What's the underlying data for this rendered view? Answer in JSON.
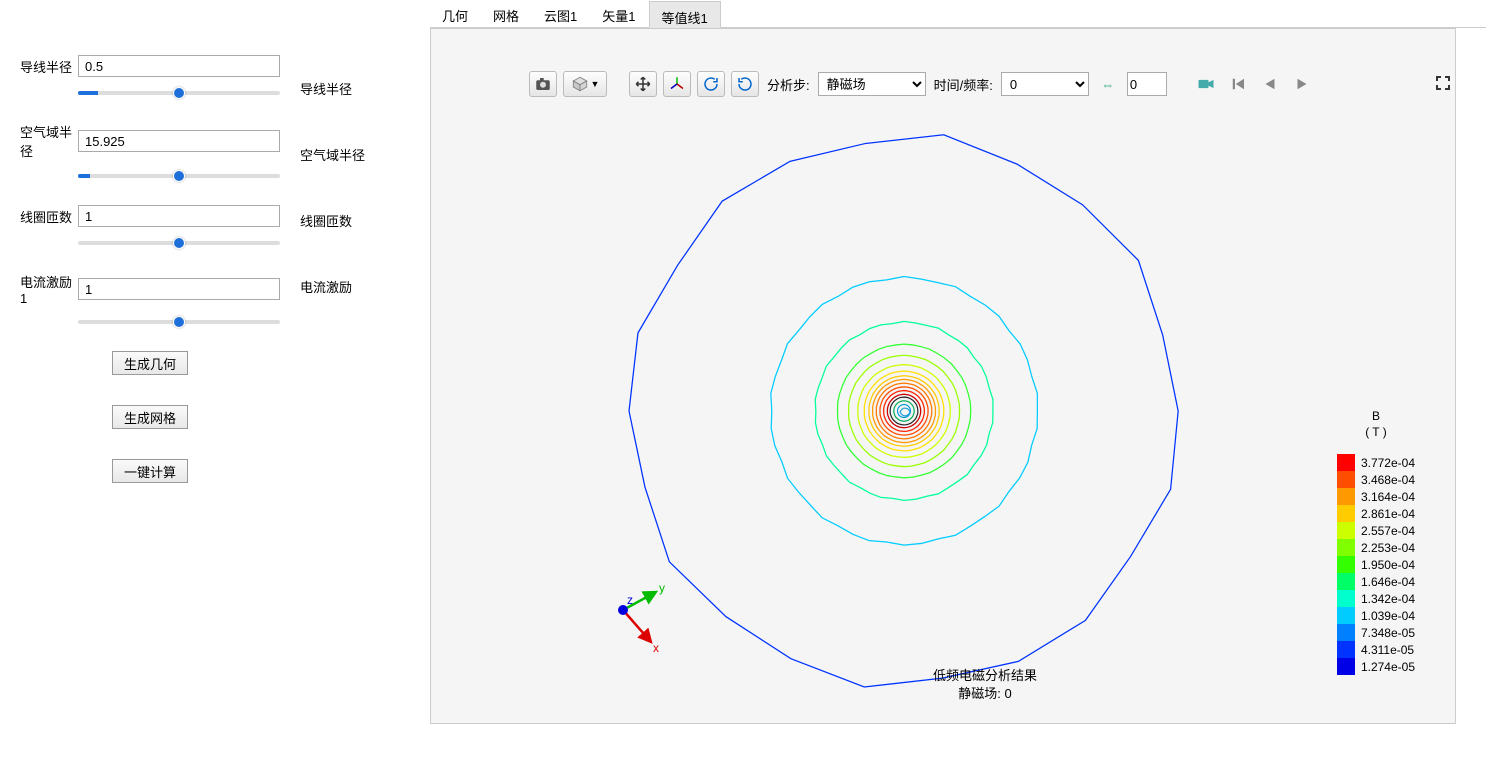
{
  "params": {
    "wire_radius": {
      "label": "导线半径",
      "value": "0.5",
      "slider_percent": 10
    },
    "air_radius": {
      "label": "空气域半径",
      "value": "15.925",
      "slider_percent": 6
    },
    "coil_turns": {
      "label": "线圈匝数",
      "value": "1",
      "slider_percent": 0
    },
    "current_exc": {
      "label": "电流激励1",
      "value": "1",
      "slider_percent": 0
    }
  },
  "mid_labels": {
    "wire_radius": "导线半径",
    "air_radius": "空气域半径",
    "coil_turns": "线圈匝数",
    "current_exc": "电流激励"
  },
  "buttons": {
    "gen_geom": "生成几何",
    "gen_mesh": "生成网格",
    "compute": "一键计算"
  },
  "tabs": [
    "几何",
    "网格",
    "云图1",
    "矢量1",
    "等值线1"
  ],
  "active_tab_index": 4,
  "toolbar": {
    "step_label": "分析步:",
    "step_value": "静磁场",
    "time_label": "时间/频率:",
    "time_value": "0",
    "spinner_value": "0"
  },
  "legend": {
    "title_line1": "B",
    "title_line2": "( T )",
    "entries": [
      {
        "color": "#ff0000",
        "value": "3.772e-04"
      },
      {
        "color": "#ff4d00",
        "value": "3.468e-04"
      },
      {
        "color": "#ff9900",
        "value": "3.164e-04"
      },
      {
        "color": "#ffcc00",
        "value": "2.861e-04"
      },
      {
        "color": "#ccff00",
        "value": "2.557e-04"
      },
      {
        "color": "#80ff00",
        "value": "2.253e-04"
      },
      {
        "color": "#33ff00",
        "value": "1.950e-04"
      },
      {
        "color": "#00ff66",
        "value": "1.646e-04"
      },
      {
        "color": "#00ffcc",
        "value": "1.342e-04"
      },
      {
        "color": "#00ccff",
        "value": "1.039e-04"
      },
      {
        "color": "#0080ff",
        "value": "7.348e-05"
      },
      {
        "color": "#0033ff",
        "value": "4.311e-05"
      },
      {
        "color": "#0000e6",
        "value": "1.274e-05"
      }
    ]
  },
  "footer": {
    "line1": "低频电磁分析结果",
    "line2": "静磁场: 0"
  },
  "triad": {
    "x": "x",
    "y": "y",
    "z": "z"
  },
  "chart_data": {
    "type": "contour",
    "field": "B",
    "unit": "T",
    "center": {
      "x": 0,
      "y": 0
    },
    "domain_radius": 15.925,
    "contours": [
      {
        "level": 1.274e-05,
        "approx_radius": 14.8,
        "color": "#0033ff"
      },
      {
        "level": 4.311e-05,
        "approx_radius": 7.2,
        "color": "#00ccff"
      },
      {
        "level": 7.348e-05,
        "approx_radius": 4.8,
        "color": "#00ff99"
      },
      {
        "level": 0.0001039,
        "approx_radius": 3.6,
        "color": "#33ff33"
      },
      {
        "level": 0.0001342,
        "approx_radius": 3.0,
        "color": "#99ff00"
      },
      {
        "level": 0.0001646,
        "approx_radius": 2.5,
        "color": "#ccff00"
      },
      {
        "level": 0.000195,
        "approx_radius": 2.15,
        "color": "#ffe000"
      },
      {
        "level": 0.0002253,
        "approx_radius": 1.9,
        "color": "#ffcc00"
      },
      {
        "level": 0.0002557,
        "approx_radius": 1.7,
        "color": "#ff9900"
      },
      {
        "level": 0.0002861,
        "approx_radius": 1.5,
        "color": "#ff7700"
      },
      {
        "level": 0.0003164,
        "approx_radius": 1.3,
        "color": "#ff4d00"
      },
      {
        "level": 0.0003468,
        "approx_radius": 1.1,
        "color": "#ff2200"
      },
      {
        "level": 0.0003772,
        "approx_radius": 0.9,
        "color": "#cc0000"
      }
    ],
    "inner_features": [
      {
        "approx_radius": 0.75,
        "color": "#222222"
      },
      {
        "approx_radius": 0.55,
        "color": "#00aa55"
      },
      {
        "approx_radius": 0.35,
        "color": "#0099dd"
      }
    ]
  }
}
